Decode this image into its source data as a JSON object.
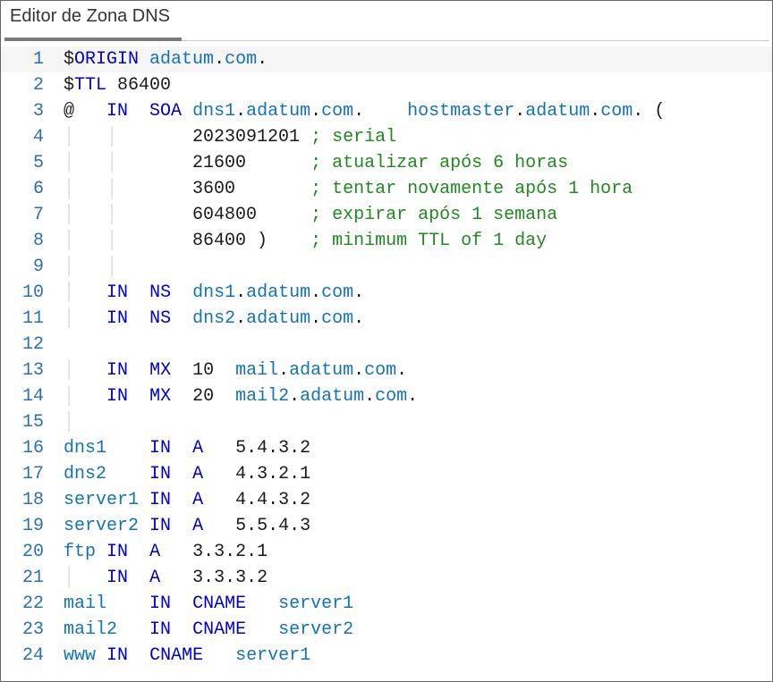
{
  "title": "Editor de Zona DNS",
  "lines": [
    {
      "n": 1,
      "current": true,
      "segs": [
        {
          "t": "$",
          "c": "blk"
        },
        {
          "t": "ORIGIN",
          "c": "dir"
        },
        {
          "t": " ",
          "c": "blk"
        },
        {
          "t": "adatum",
          "c": "host"
        },
        {
          "t": ".",
          "c": "blk"
        },
        {
          "t": "com",
          "c": "host"
        },
        {
          "t": ".",
          "c": "blk"
        }
      ]
    },
    {
      "n": 2,
      "segs": [
        {
          "t": "$",
          "c": "blk"
        },
        {
          "t": "TTL",
          "c": "dir"
        },
        {
          "t": " 86400",
          "c": "blk"
        }
      ]
    },
    {
      "n": 3,
      "segs": [
        {
          "t": "@   ",
          "c": "blk"
        },
        {
          "t": "IN",
          "c": "kw"
        },
        {
          "t": "  ",
          "c": "blk"
        },
        {
          "t": "SOA",
          "c": "kw"
        },
        {
          "t": " ",
          "c": "blk"
        },
        {
          "t": "dns1",
          "c": "host"
        },
        {
          "t": ".",
          "c": "blk"
        },
        {
          "t": "adatum",
          "c": "host"
        },
        {
          "t": ".",
          "c": "blk"
        },
        {
          "t": "com",
          "c": "host"
        },
        {
          "t": ".    ",
          "c": "blk"
        },
        {
          "t": "hostmaster",
          "c": "host"
        },
        {
          "t": ".",
          "c": "blk"
        },
        {
          "t": "adatum",
          "c": "host"
        },
        {
          "t": ".",
          "c": "blk"
        },
        {
          "t": "com",
          "c": "host"
        },
        {
          "t": ". (",
          "c": "blk"
        }
      ]
    },
    {
      "n": 4,
      "segs": [
        {
          "t": "│   │",
          "c": "ig"
        },
        {
          "t": "       2023091201 ",
          "c": "blk"
        },
        {
          "t": "; serial",
          "c": "cmt"
        }
      ]
    },
    {
      "n": 5,
      "segs": [
        {
          "t": "│   │",
          "c": "ig"
        },
        {
          "t": "       21600      ",
          "c": "blk"
        },
        {
          "t": "; atualizar após 6 horas",
          "c": "cmt"
        }
      ]
    },
    {
      "n": 6,
      "segs": [
        {
          "t": "│   │",
          "c": "ig"
        },
        {
          "t": "       3600       ",
          "c": "blk"
        },
        {
          "t": "; tentar novamente após 1 hora",
          "c": "cmt"
        }
      ]
    },
    {
      "n": 7,
      "segs": [
        {
          "t": "│   │",
          "c": "ig"
        },
        {
          "t": "       604800     ",
          "c": "blk"
        },
        {
          "t": "; expirar após 1 semana",
          "c": "cmt"
        }
      ]
    },
    {
      "n": 8,
      "segs": [
        {
          "t": "│   │",
          "c": "ig"
        },
        {
          "t": "       86400 )    ",
          "c": "blk"
        },
        {
          "t": "; minimum TTL of 1 day",
          "c": "cmt"
        }
      ]
    },
    {
      "n": 9,
      "segs": [
        {
          "t": "│   │",
          "c": "ig"
        }
      ]
    },
    {
      "n": 10,
      "segs": [
        {
          "t": "│",
          "c": "ig"
        },
        {
          "t": "   ",
          "c": "blk"
        },
        {
          "t": "IN",
          "c": "kw"
        },
        {
          "t": "  ",
          "c": "blk"
        },
        {
          "t": "NS",
          "c": "kw"
        },
        {
          "t": "  ",
          "c": "blk"
        },
        {
          "t": "dns1",
          "c": "host"
        },
        {
          "t": ".",
          "c": "blk"
        },
        {
          "t": "adatum",
          "c": "host"
        },
        {
          "t": ".",
          "c": "blk"
        },
        {
          "t": "com",
          "c": "host"
        },
        {
          "t": ".",
          "c": "blk"
        }
      ]
    },
    {
      "n": 11,
      "segs": [
        {
          "t": "│",
          "c": "ig"
        },
        {
          "t": "   ",
          "c": "blk"
        },
        {
          "t": "IN",
          "c": "kw"
        },
        {
          "t": "  ",
          "c": "blk"
        },
        {
          "t": "NS",
          "c": "kw"
        },
        {
          "t": "  ",
          "c": "blk"
        },
        {
          "t": "dns2",
          "c": "host"
        },
        {
          "t": ".",
          "c": "blk"
        },
        {
          "t": "adatum",
          "c": "host"
        },
        {
          "t": ".",
          "c": "blk"
        },
        {
          "t": "com",
          "c": "host"
        },
        {
          "t": ".",
          "c": "blk"
        }
      ]
    },
    {
      "n": 12,
      "segs": [
        {
          "t": " ",
          "c": "blk"
        }
      ]
    },
    {
      "n": 13,
      "segs": [
        {
          "t": "│",
          "c": "ig"
        },
        {
          "t": "   ",
          "c": "blk"
        },
        {
          "t": "IN",
          "c": "kw"
        },
        {
          "t": "  ",
          "c": "blk"
        },
        {
          "t": "MX",
          "c": "kw"
        },
        {
          "t": "  10  ",
          "c": "blk"
        },
        {
          "t": "mail",
          "c": "host"
        },
        {
          "t": ".",
          "c": "blk"
        },
        {
          "t": "adatum",
          "c": "host"
        },
        {
          "t": ".",
          "c": "blk"
        },
        {
          "t": "com",
          "c": "host"
        },
        {
          "t": ".",
          "c": "blk"
        }
      ]
    },
    {
      "n": 14,
      "segs": [
        {
          "t": "│",
          "c": "ig"
        },
        {
          "t": "   ",
          "c": "blk"
        },
        {
          "t": "IN",
          "c": "kw"
        },
        {
          "t": "  ",
          "c": "blk"
        },
        {
          "t": "MX",
          "c": "kw"
        },
        {
          "t": "  20  ",
          "c": "blk"
        },
        {
          "t": "mail2",
          "c": "host"
        },
        {
          "t": ".",
          "c": "blk"
        },
        {
          "t": "adatum",
          "c": "host"
        },
        {
          "t": ".",
          "c": "blk"
        },
        {
          "t": "com",
          "c": "host"
        },
        {
          "t": ".",
          "c": "blk"
        }
      ]
    },
    {
      "n": 15,
      "segs": [
        {
          "t": "│",
          "c": "ig"
        }
      ]
    },
    {
      "n": 16,
      "segs": [
        {
          "t": "dns1",
          "c": "host"
        },
        {
          "t": "    ",
          "c": "blk"
        },
        {
          "t": "IN",
          "c": "kw"
        },
        {
          "t": "  ",
          "c": "blk"
        },
        {
          "t": "A",
          "c": "kw"
        },
        {
          "t": "   5.4.3.2",
          "c": "blk"
        }
      ]
    },
    {
      "n": 17,
      "segs": [
        {
          "t": "dns2",
          "c": "host"
        },
        {
          "t": "    ",
          "c": "blk"
        },
        {
          "t": "IN",
          "c": "kw"
        },
        {
          "t": "  ",
          "c": "blk"
        },
        {
          "t": "A",
          "c": "kw"
        },
        {
          "t": "   4.3.2.1",
          "c": "blk"
        }
      ]
    },
    {
      "n": 18,
      "segs": [
        {
          "t": "server1",
          "c": "host"
        },
        {
          "t": " ",
          "c": "blk"
        },
        {
          "t": "IN",
          "c": "kw"
        },
        {
          "t": "  ",
          "c": "blk"
        },
        {
          "t": "A",
          "c": "kw"
        },
        {
          "t": "   4.4.3.2",
          "c": "blk"
        }
      ]
    },
    {
      "n": 19,
      "segs": [
        {
          "t": "server2",
          "c": "host"
        },
        {
          "t": " ",
          "c": "blk"
        },
        {
          "t": "IN",
          "c": "kw"
        },
        {
          "t": "  ",
          "c": "blk"
        },
        {
          "t": "A",
          "c": "kw"
        },
        {
          "t": "   5.5.4.3",
          "c": "blk"
        }
      ]
    },
    {
      "n": 20,
      "segs": [
        {
          "t": "ftp",
          "c": "host"
        },
        {
          "t": " ",
          "c": "blk"
        },
        {
          "t": "IN",
          "c": "kw"
        },
        {
          "t": "  ",
          "c": "blk"
        },
        {
          "t": "A",
          "c": "kw"
        },
        {
          "t": "   3.3.2.1",
          "c": "blk"
        }
      ]
    },
    {
      "n": 21,
      "segs": [
        {
          "t": "│",
          "c": "ig"
        },
        {
          "t": "   ",
          "c": "blk"
        },
        {
          "t": "IN",
          "c": "kw"
        },
        {
          "t": "  ",
          "c": "blk"
        },
        {
          "t": "A",
          "c": "kw"
        },
        {
          "t": "   3.3.3.2",
          "c": "blk"
        }
      ]
    },
    {
      "n": 22,
      "segs": [
        {
          "t": "mail",
          "c": "host"
        },
        {
          "t": "    ",
          "c": "blk"
        },
        {
          "t": "IN",
          "c": "kw"
        },
        {
          "t": "  ",
          "c": "blk"
        },
        {
          "t": "CNAME",
          "c": "kw"
        },
        {
          "t": "   ",
          "c": "blk"
        },
        {
          "t": "server1",
          "c": "host"
        }
      ]
    },
    {
      "n": 23,
      "segs": [
        {
          "t": "mail2",
          "c": "host"
        },
        {
          "t": "   ",
          "c": "blk"
        },
        {
          "t": "IN",
          "c": "kw"
        },
        {
          "t": "  ",
          "c": "blk"
        },
        {
          "t": "CNAME",
          "c": "kw"
        },
        {
          "t": "   ",
          "c": "blk"
        },
        {
          "t": "server2",
          "c": "host"
        }
      ]
    },
    {
      "n": 24,
      "segs": [
        {
          "t": "www",
          "c": "host"
        },
        {
          "t": " ",
          "c": "blk"
        },
        {
          "t": "IN",
          "c": "kw"
        },
        {
          "t": "  ",
          "c": "blk"
        },
        {
          "t": "CNAME",
          "c": "kw"
        },
        {
          "t": "   ",
          "c": "blk"
        },
        {
          "t": "server1",
          "c": "host"
        }
      ]
    }
  ]
}
